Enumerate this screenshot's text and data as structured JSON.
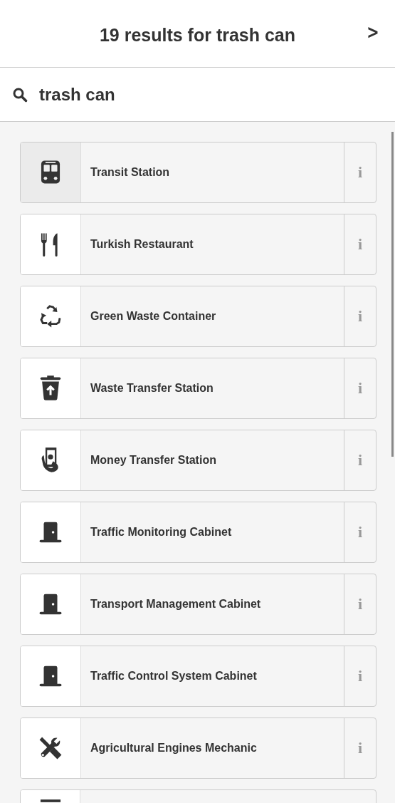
{
  "header": {
    "title": "19 results for trash can",
    "next_label": ">"
  },
  "search": {
    "value": "trash can"
  },
  "results": [
    {
      "kind": "bus",
      "label": "Transit Station",
      "info": "i",
      "selected": true
    },
    {
      "kind": "cutlery",
      "label": "Turkish Restaurant",
      "info": "i",
      "selected": false
    },
    {
      "kind": "recycle",
      "label": "Green Waste Container",
      "info": "i",
      "selected": false
    },
    {
      "kind": "trash",
      "label": "Waste Transfer Station",
      "info": "i",
      "selected": false
    },
    {
      "kind": "money",
      "label": "Money Transfer Station",
      "info": "i",
      "selected": false
    },
    {
      "kind": "door",
      "label": "Traffic Monitoring Cabinet",
      "info": "i",
      "selected": false
    },
    {
      "kind": "door",
      "label": "Transport Management Cabinet",
      "info": "i",
      "selected": false
    },
    {
      "kind": "door",
      "label": "Traffic Control System Cabinet",
      "info": "i",
      "selected": false
    },
    {
      "kind": "tools",
      "label": "Agricultural Engines Mechanic",
      "info": "i",
      "selected": false
    },
    {
      "kind": "bar",
      "selected": false
    }
  ]
}
